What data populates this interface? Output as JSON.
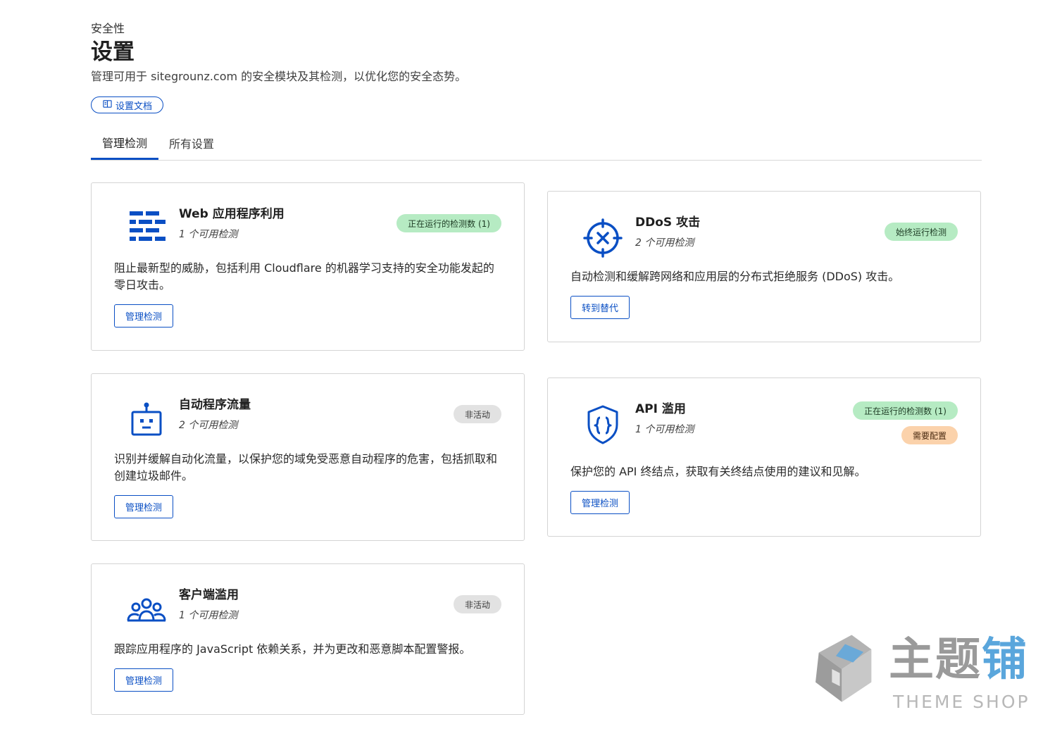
{
  "header": {
    "breadcrumb": "安全性",
    "title": "设置",
    "description": "管理可用于 sitegrounz.com 的安全模块及其检测，以优化您的安全态势。",
    "docs_button": "设置文档"
  },
  "tabs": [
    {
      "label": "管理检测",
      "active": true
    },
    {
      "label": "所有设置",
      "active": false
    }
  ],
  "colors": {
    "accent": "#0a4fc4",
    "badge_green": "#b6ebc3",
    "badge_grey": "#e2e2e2",
    "badge_orange": "#fbd2ab"
  },
  "cards": {
    "web": {
      "icon": "firewall-bricks-icon",
      "title": "Web 应用程序利用",
      "subtitle": "1 个可用检测",
      "badges": [
        "正在运行的检测数 (1)"
      ],
      "description": "阻止最新型的威胁，包括利用 Cloudflare 的机器学习支持的安全功能发起的零日攻击。",
      "button": "管理检测"
    },
    "ddos": {
      "icon": "crosshair-target-icon",
      "title": "DDoS 攻击",
      "subtitle": "2 个可用检测",
      "badges": [
        "始终运行检测"
      ],
      "description": "自动检测和缓解跨网络和应用层的分布式拒绝服务 (DDoS) 攻击。",
      "button": "转到替代"
    },
    "bot": {
      "icon": "robot-icon",
      "title": "自动程序流量",
      "subtitle": "2 个可用检测",
      "badges": [
        "非活动"
      ],
      "description": "识别并缓解自动化流量，以保护您的域免受恶意自动程序的危害，包括抓取和创建垃圾邮件。",
      "button": "管理检测"
    },
    "api": {
      "icon": "api-shield-icon",
      "title": "API 滥用",
      "subtitle": "1 个可用检测",
      "badges": [
        "正在运行的检测数 (1)",
        "需要配置"
      ],
      "description": "保护您的 API 终结点，获取有关终结点使用的建议和见解。",
      "button": "管理检测"
    },
    "client": {
      "icon": "users-group-icon",
      "title": "客户端滥用",
      "subtitle": "1 个可用检测",
      "badges": [
        "非活动"
      ],
      "description": "跟踪应用程序的 JavaScript 依赖关系，并为更改和恶意脚本配置警报。",
      "button": "管理检测"
    }
  },
  "watermark": {
    "title_main": "主题",
    "title_accent": "铺",
    "subtitle": "THEME SHOP"
  }
}
